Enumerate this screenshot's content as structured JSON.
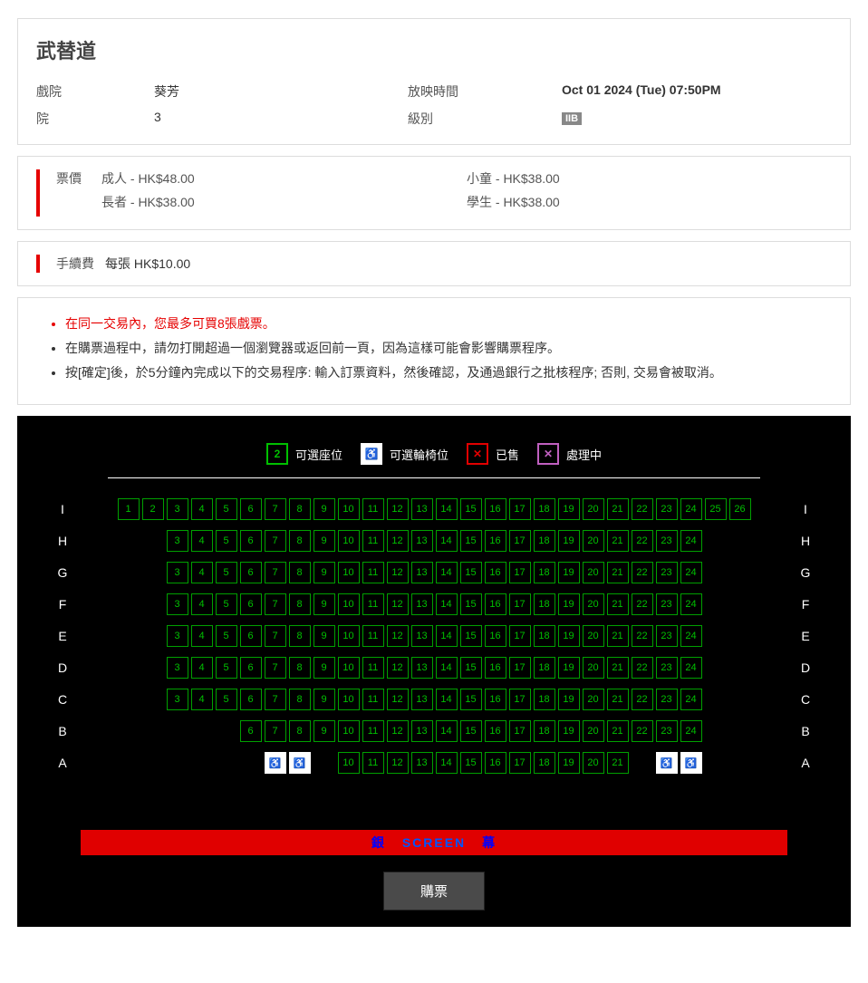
{
  "movie": {
    "title": "武替道"
  },
  "info": {
    "cinema_label": "戲院",
    "cinema_value": "葵芳",
    "house_label": "院",
    "house_value": "3",
    "showtime_label": "放映時間",
    "showtime_value": "Oct 01 2024 (Tue) 07:50PM",
    "rating_label": "級別",
    "rating_value": "IIB"
  },
  "price": {
    "label": "票價",
    "items": [
      "成人 - HK$48.00",
      "長者 - HK$38.00",
      "小童 - HK$38.00",
      "學生 - HK$38.00"
    ]
  },
  "fee": {
    "label": "手續費",
    "value": "每張 HK$10.00"
  },
  "rules": [
    "在同一交易內，您最多可買8張戲票。",
    "在購票過程中，請勿打開超過一個瀏覽器或返回前一頁，因為這樣可能會影響購票程序。",
    "按[確定]後，於5分鐘內完成以下的交易程序: 輸入訂票資料，然後確認，及通過銀行之批核程序; 否則, 交易會被取消。"
  ],
  "legend": {
    "available": "可選座位",
    "wheelchair": "可選輪椅位",
    "sold": "已售",
    "processing": "處理中",
    "sample_num": "2",
    "wheel_icon": "♿",
    "sold_icon": "✕",
    "proc_icon": "✕"
  },
  "screen": {
    "zh1": "銀",
    "en": "SCREEN",
    "zh2": "幕"
  },
  "buy_button": "購票",
  "seat_rows": [
    {
      "label": "I",
      "start": 1,
      "end": 26,
      "wheels": []
    },
    {
      "label": "H",
      "start": 3,
      "end": 24,
      "wheels": []
    },
    {
      "label": "G",
      "start": 3,
      "end": 24,
      "wheels": []
    },
    {
      "label": "F",
      "start": 3,
      "end": 24,
      "wheels": []
    },
    {
      "label": "E",
      "start": 3,
      "end": 24,
      "wheels": []
    },
    {
      "label": "D",
      "start": 3,
      "end": 24,
      "wheels": []
    },
    {
      "label": "C",
      "start": 3,
      "end": 24,
      "wheels": []
    },
    {
      "label": "B",
      "start": 6,
      "end": 24,
      "wheels": []
    },
    {
      "label": "A",
      "start": 10,
      "end": 21,
      "wheels": [
        7,
        8,
        23,
        24
      ]
    }
  ],
  "max_cols": 26
}
